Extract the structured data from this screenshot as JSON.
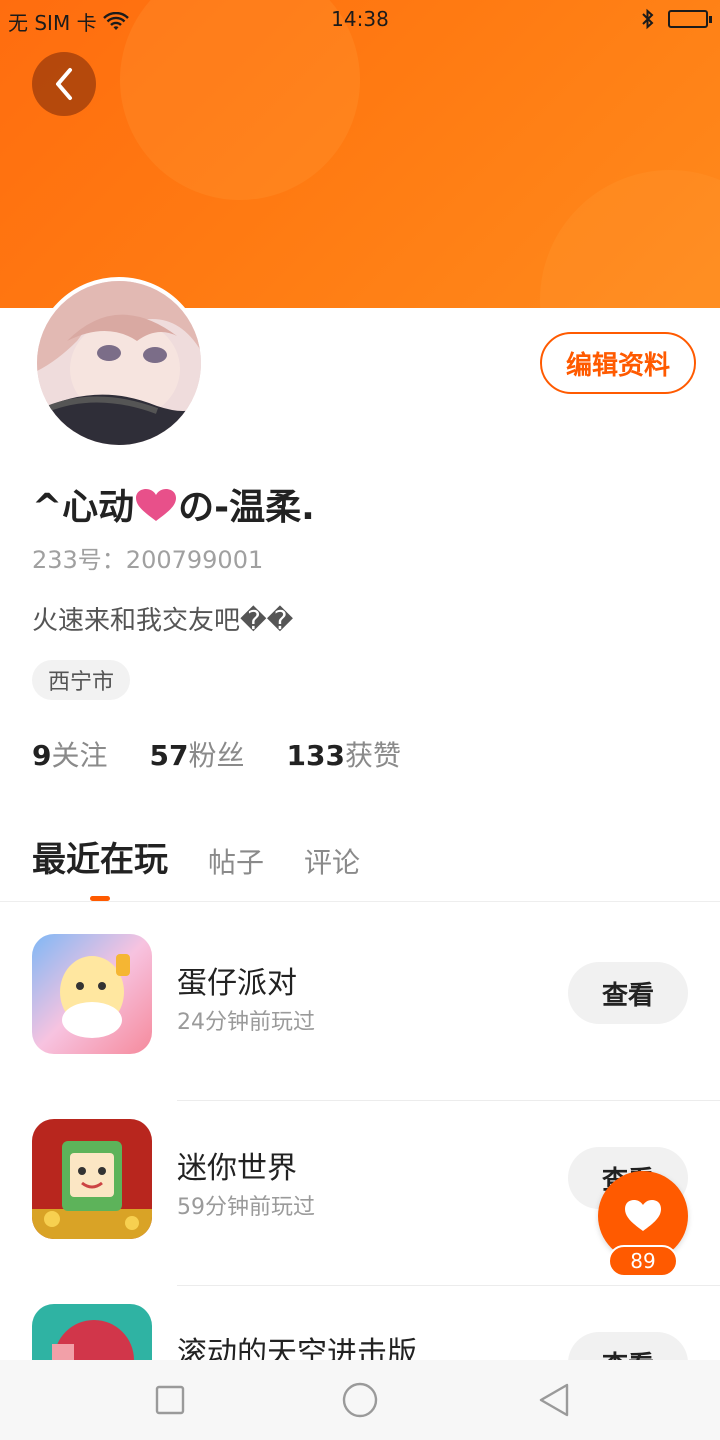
{
  "status_bar": {
    "carrier": "无 SIM 卡",
    "time": "14:38"
  },
  "profile": {
    "edit_label": "编辑资料",
    "nickname_prefix": "^心动",
    "nickname_suffix": "の-温柔.",
    "uid": "233号：200799001",
    "bio": "火速来和我交友吧��",
    "location": "西宁市"
  },
  "stats": [
    {
      "count": "9",
      "label": "关注"
    },
    {
      "count": "57",
      "label": "粉丝"
    },
    {
      "count": "133",
      "label": "获赞"
    }
  ],
  "tabs": [
    {
      "label": "最近在玩",
      "active": true
    },
    {
      "label": "帖子",
      "active": false
    },
    {
      "label": "评论",
      "active": false
    }
  ],
  "games": [
    {
      "name": "蛋仔派对",
      "played": "24分钟前玩过",
      "action": "查看"
    },
    {
      "name": "迷你世界",
      "played": "59分钟前玩过",
      "action": "查看"
    },
    {
      "name": "滚动的天空进击版",
      "played": "",
      "action": "查看"
    }
  ],
  "like_fab": {
    "count": "89"
  },
  "colors": {
    "accent": "#ff5a00",
    "banner": "#ff7a12"
  }
}
